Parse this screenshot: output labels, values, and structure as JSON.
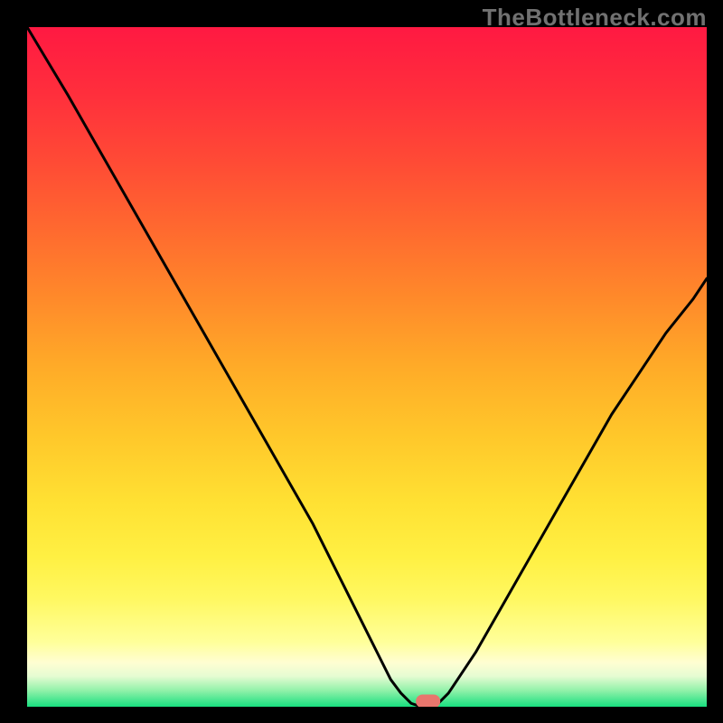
{
  "watermark": "TheBottleneck.com",
  "chart_data": {
    "type": "line",
    "title": "",
    "xlabel": "",
    "ylabel": "",
    "x_range": [
      0,
      100
    ],
    "y_range": [
      0,
      100
    ],
    "curve_points_x": [
      0,
      3,
      6,
      10,
      14,
      18,
      22,
      26,
      30,
      34,
      38,
      42,
      44,
      46,
      48,
      50,
      52,
      53.5,
      55,
      56.5,
      58,
      60,
      62,
      66,
      70,
      74,
      78,
      82,
      86,
      90,
      94,
      98,
      100
    ],
    "curve_points_y": [
      100,
      95,
      90,
      83,
      76,
      69,
      62,
      55,
      48,
      41,
      34,
      27,
      23,
      19,
      15,
      11,
      7,
      4,
      2,
      0.5,
      0,
      0,
      2,
      8,
      15,
      22,
      29,
      36,
      43,
      49,
      55,
      60,
      63
    ],
    "marker": {
      "x": 59,
      "y": 0.8,
      "rx": 1.8,
      "ry": 1.0
    },
    "gradient_stops": [
      {
        "offset": 0.0,
        "color": "#ff1942"
      },
      {
        "offset": 0.1,
        "color": "#ff2f3c"
      },
      {
        "offset": 0.2,
        "color": "#ff4b35"
      },
      {
        "offset": 0.3,
        "color": "#ff6a2f"
      },
      {
        "offset": 0.4,
        "color": "#ff8a2a"
      },
      {
        "offset": 0.5,
        "color": "#ffab28"
      },
      {
        "offset": 0.6,
        "color": "#ffc72a"
      },
      {
        "offset": 0.7,
        "color": "#ffe133"
      },
      {
        "offset": 0.78,
        "color": "#fff043"
      },
      {
        "offset": 0.84,
        "color": "#fff860"
      },
      {
        "offset": 0.905,
        "color": "#ffff9a"
      },
      {
        "offset": 0.935,
        "color": "#fffed2"
      },
      {
        "offset": 0.955,
        "color": "#e6fcd2"
      },
      {
        "offset": 0.975,
        "color": "#96f2ab"
      },
      {
        "offset": 1.0,
        "color": "#18df7f"
      }
    ]
  }
}
